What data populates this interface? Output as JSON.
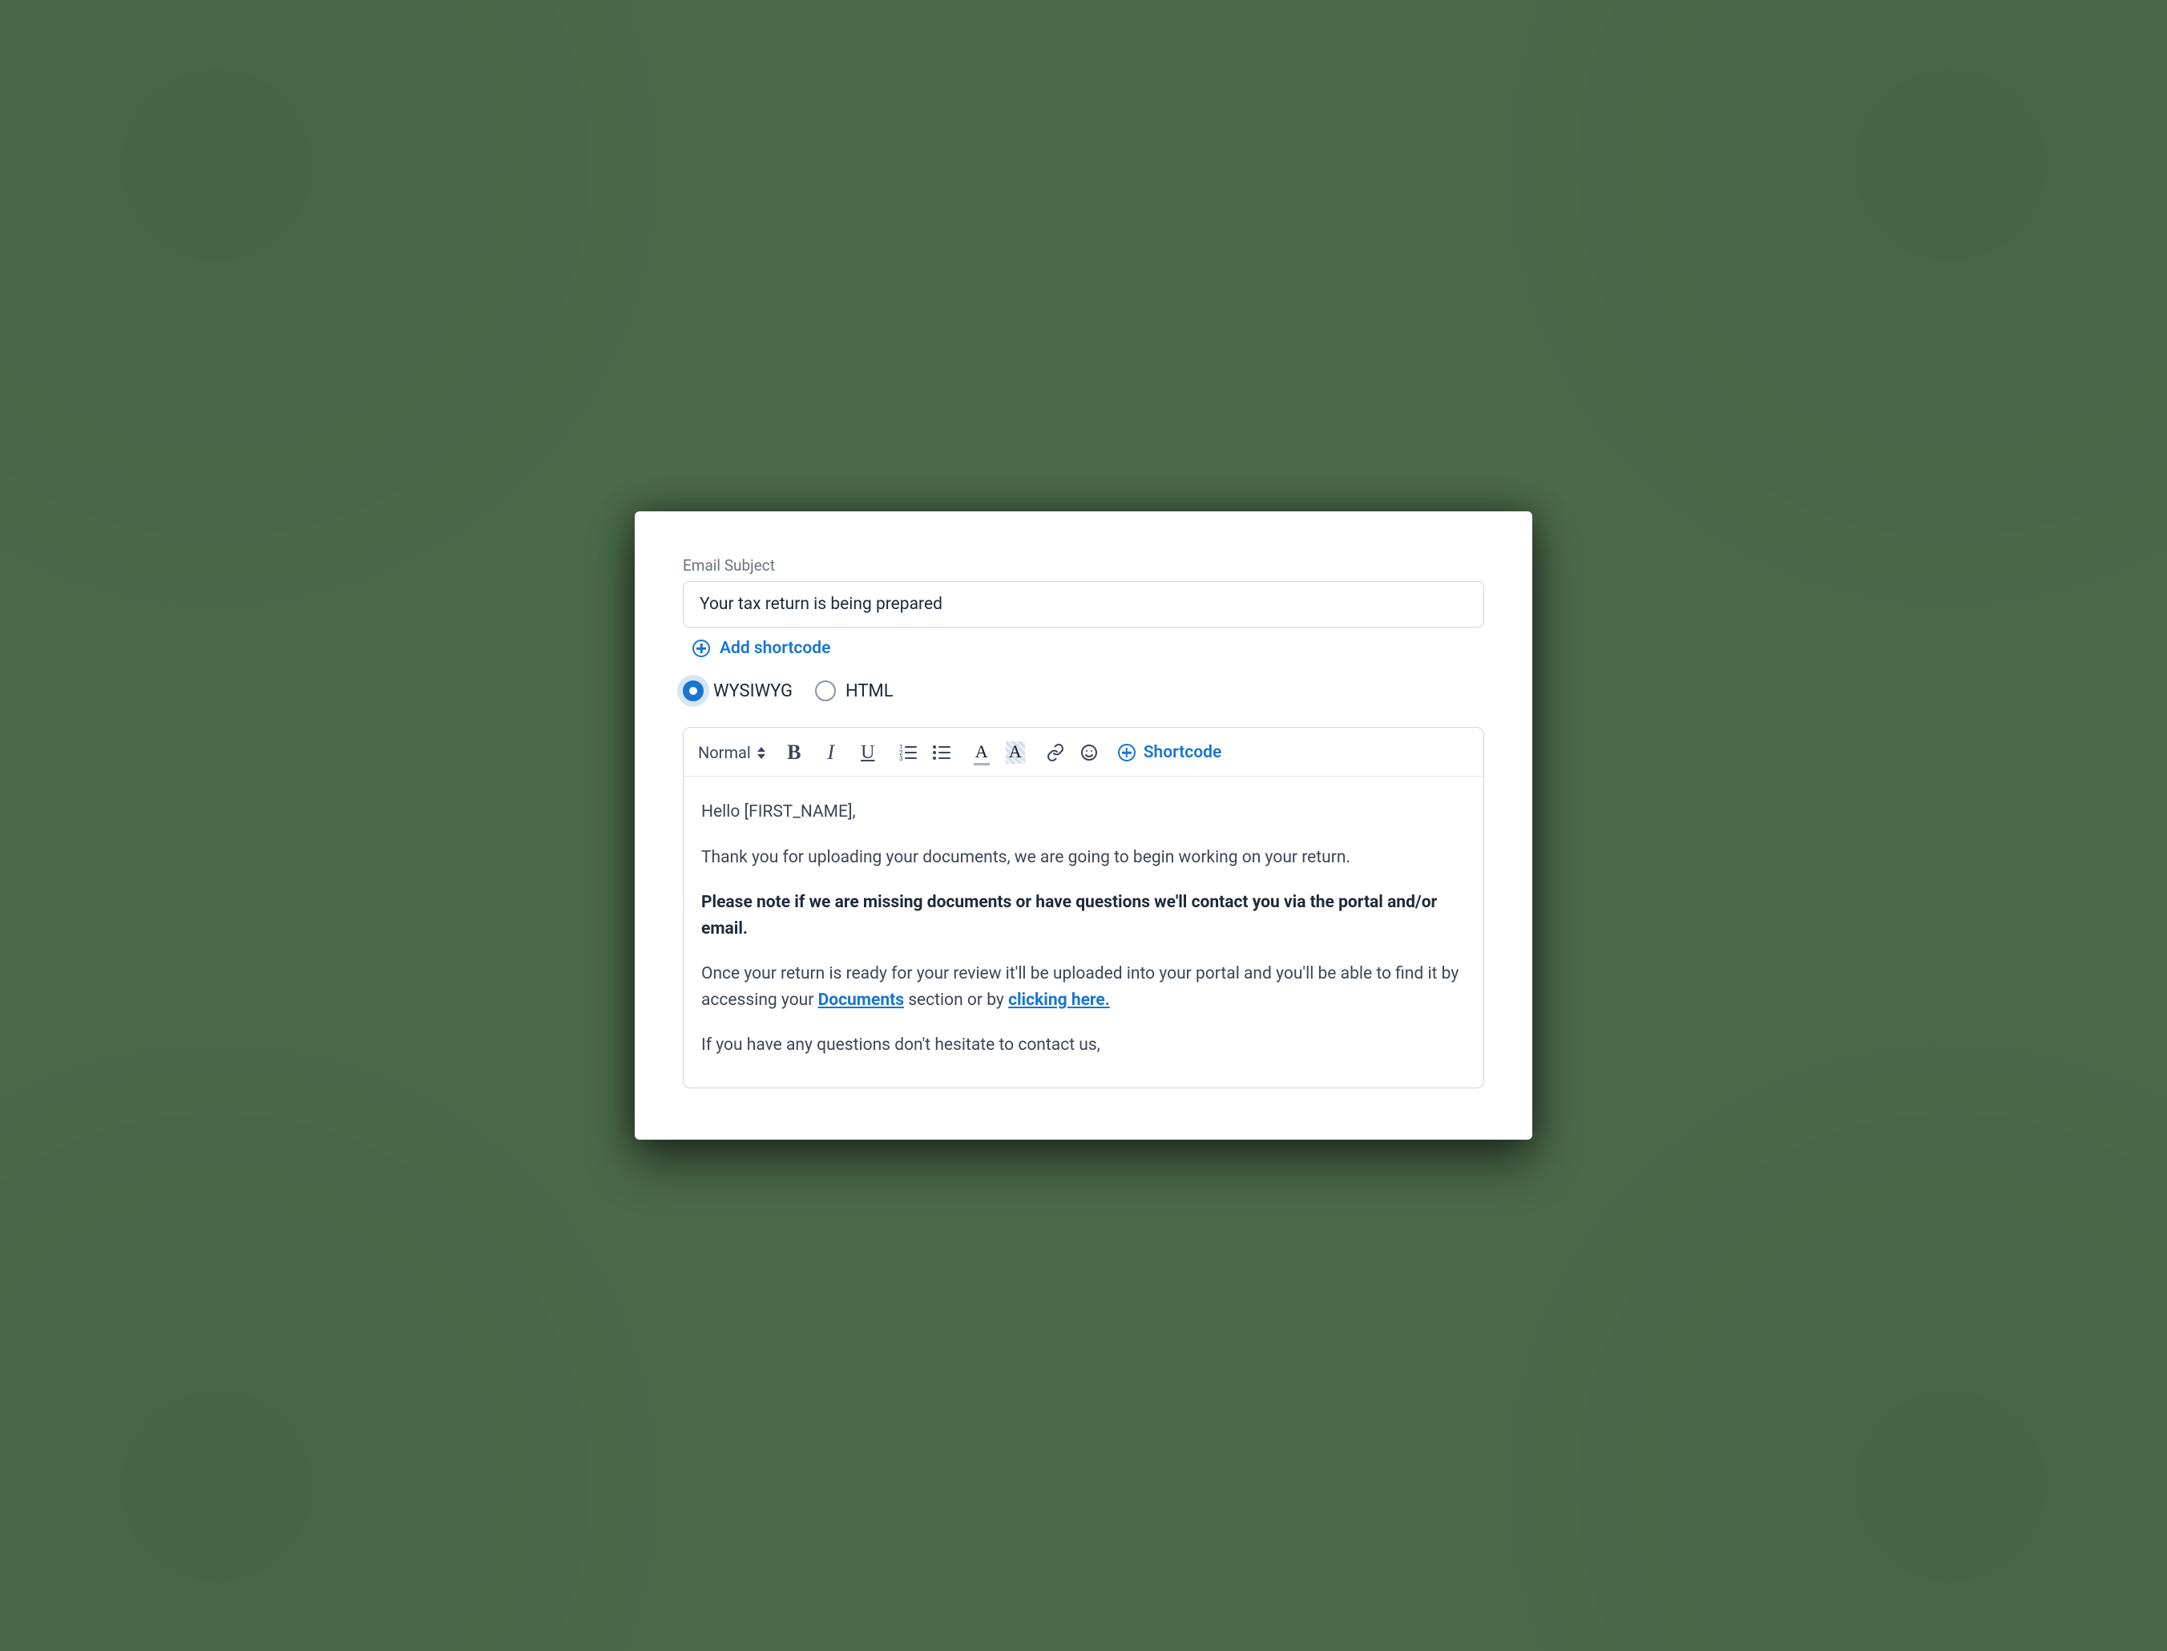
{
  "subject": {
    "label": "Email Subject",
    "value": "Your tax return is being prepared",
    "add_shortcode_label": "Add shortcode"
  },
  "mode": {
    "wysiwyg": "WYSIWYG",
    "html": "HTML",
    "selected": "wysiwyg"
  },
  "toolbar": {
    "format_label": "Normal",
    "shortcode_label": "Shortcode"
  },
  "body": {
    "p1_prefix": "Hello ",
    "p1_token": "[FIRST_NAME]",
    "p1_suffix": ",",
    "p2": "Thank you for uploading your documents, we are going to begin working on your return.",
    "p3": "Please note if we are missing documents or have questions we'll contact you via the portal and/or email.",
    "p4_a": "Once your return is ready for your review it'll be uploaded into your portal and you'll be able to find it by accessing your ",
    "p4_link1": "Documents",
    "p4_b": " section or by ",
    "p4_link2": "clicking here.",
    "p5": "If you have any questions don't hesitate to contact us,"
  }
}
